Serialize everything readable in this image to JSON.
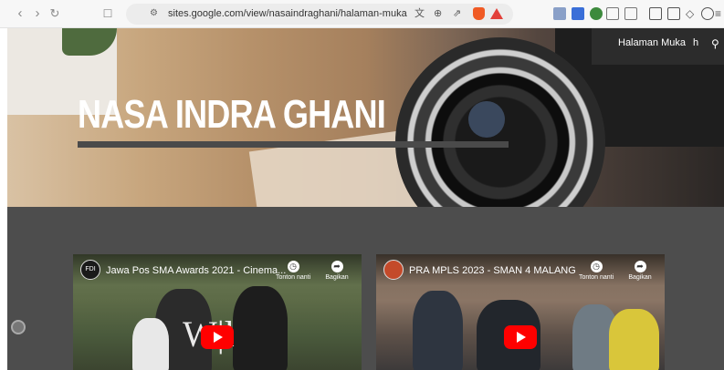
{
  "browser": {
    "url": "sites.google.com/view/nasaindraghani/halaman-muka",
    "icons": [
      "back-icon",
      "forward-icon",
      "reload-icon",
      "bookmark-icon",
      "site-settings-icon",
      "translate-icon",
      "zoom-icon",
      "share-icon",
      "brave-shield-icon",
      "brave-rewards-icon",
      "extension-icons",
      "sidebar-icon",
      "wallet-icon",
      "menu-icon"
    ]
  },
  "site": {
    "title": "NASA INDRA GHANI",
    "nav": {
      "home": "Halaman Muka",
      "more": "h"
    }
  },
  "videos": [
    {
      "channel_badge": "FDI",
      "title": "Jawa Pos SMA Awards 2021 - Cinema...",
      "watch_later": "Tonton nanti",
      "share": "Bagikan"
    },
    {
      "channel_badge": "",
      "title": "PRA MPLS 2023 - SMAN 4 MALANG",
      "watch_later": "Tonton nanti",
      "share": "Bagikan"
    }
  ],
  "colors": {
    "page_bg": "#4d4d4d",
    "play_button": "#ff0000",
    "title_text": "#ffffff"
  }
}
